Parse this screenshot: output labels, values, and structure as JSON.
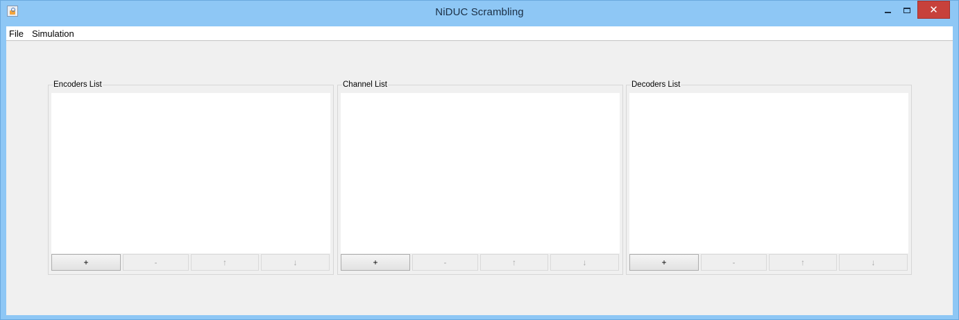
{
  "window": {
    "title": "NiDUC Scrambling",
    "close_glyph": "✕"
  },
  "menu": {
    "items": [
      "File",
      "Simulation"
    ]
  },
  "panels": [
    {
      "title": "Encoders List",
      "buttons": [
        {
          "label": "+",
          "enabled": true
        },
        {
          "label": "-",
          "enabled": false
        },
        {
          "label": "↑",
          "enabled": false
        },
        {
          "label": "↓",
          "enabled": false
        }
      ]
    },
    {
      "title": "Channel List",
      "buttons": [
        {
          "label": "+",
          "enabled": true
        },
        {
          "label": "-",
          "enabled": false
        },
        {
          "label": "↑",
          "enabled": false
        },
        {
          "label": "↓",
          "enabled": false
        }
      ]
    },
    {
      "title": "Decoders List",
      "buttons": [
        {
          "label": "+",
          "enabled": true
        },
        {
          "label": "-",
          "enabled": false
        },
        {
          "label": "↑",
          "enabled": false
        },
        {
          "label": "↓",
          "enabled": false
        }
      ]
    }
  ],
  "colors": {
    "titlebar": "#8ec7f5",
    "close_button": "#c7413b",
    "client_background": "#f0f0f0"
  }
}
